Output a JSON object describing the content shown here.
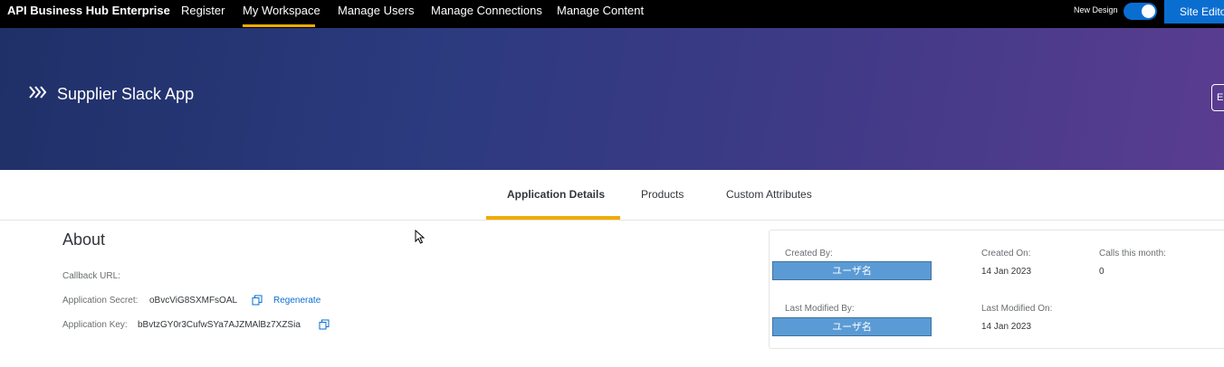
{
  "nav": {
    "brand": "API Business Hub Enterprise",
    "items": [
      "Register",
      "My Workspace",
      "Manage Users",
      "Manage Connections",
      "Manage Content"
    ],
    "active_index": 1,
    "new_design_label": "New Design",
    "site_editor_label": "Site Edito",
    "colors": {
      "background": "#000000",
      "accent": "#f0ab00",
      "toggle": "#0a6ed1"
    }
  },
  "hero": {
    "icon": "chevron-triple-right-icon",
    "title": "Supplier Slack App",
    "edit_label": "E"
  },
  "tabs": {
    "items": [
      "Application Details",
      "Products",
      "Custom Attributes"
    ],
    "active_index": 0
  },
  "about": {
    "title": "About",
    "callback_label": "Callback URL:",
    "callback_value": "",
    "secret_label": "Application Secret:",
    "secret_value": "oBvcViG8SXMFsOAL",
    "regenerate_label": "Regenerate",
    "key_label": "Application Key:",
    "key_value": "bBvtzGY0r3CufwSYa7AJZMAlBz7XZSia"
  },
  "details": {
    "created_by_label": "Created By:",
    "created_by_value": "ユーザ名",
    "created_on_label": "Created On:",
    "created_on_value": "14 Jan 2023",
    "calls_label": "Calls this month:",
    "calls_value": "0",
    "modified_by_label": "Last Modified By:",
    "modified_by_value": "ユーザ名",
    "modified_on_label": "Last Modified On:",
    "modified_on_value": "14 Jan 2023"
  }
}
